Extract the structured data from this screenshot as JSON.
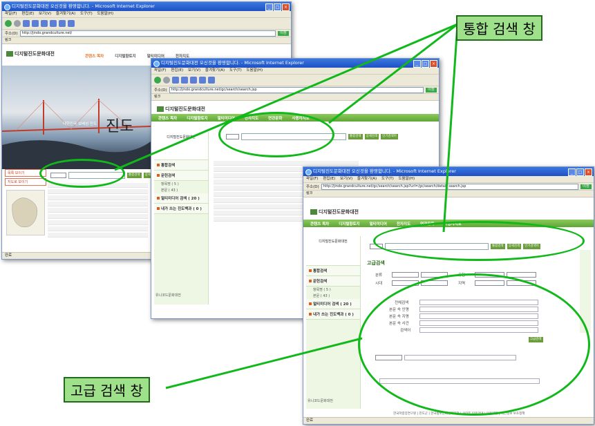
{
  "browser": {
    "title_suffix": "Microsoft Internet Explorer",
    "title_prefix": "디지털진도문화대전 오신것을 환영합니다.",
    "menu": [
      "파일(F)",
      "편집(E)",
      "보기(V)",
      "즐겨찾기(A)",
      "도구(T)",
      "도움말(H)"
    ],
    "toolbar": [
      "뒤로",
      "앞으로",
      "중지",
      "새로고침",
      "홈",
      "검색",
      "즐겨찾기",
      "인쇄"
    ],
    "address_label": "주소(D)",
    "go_label": "이동",
    "links_label": "링크",
    "status_text": "완료",
    "win1_address": "http://jindo.grandculture.net/",
    "win2_address": "http://jindo.grandculture.net/gc/search/search.jsp",
    "win3_address": "http://jindo.grandculture.net/gc/search/search.jsp?url=/gc/search/detail_search.jsp"
  },
  "site": {
    "name": "디지털진도문화대전",
    "nav": [
      "콘텐츠 목차",
      "디지털향토지",
      "멀티미디어",
      "전자지도",
      "연관문화",
      "사용자지도"
    ],
    "search_buttons": [
      "통합검색",
      "상세검색",
      "인기검색어",
      "테마/이야기마당"
    ],
    "home_hero_text": "진도",
    "home_slogan": "대한민국 보배섬 진도",
    "home_buttons": [
      "목록 보이기",
      "지도로 보이기"
    ],
    "sidebar_title": "통합검색",
    "sidebar_items": [
      {
        "label": "통합검색",
        "subs": []
      },
      {
        "label": "문헌검색",
        "subs": [
          "항목명 ( 5 )",
          "본문 ( 43 )"
        ]
      },
      {
        "label": "멀티미디어 검색 ( 20 )",
        "subs": []
      },
      {
        "label": "내가 쓰는 진도백과 ( 0 )",
        "subs": []
      }
    ],
    "detail_title": "고급검색",
    "detail_labels": [
      "분류",
      "유형",
      "시대",
      "지역",
      "전체검색",
      "본문 속 인명",
      "본문 속 지명",
      "본문 속 사건",
      "검색어"
    ],
    "footer": "한국학중앙연구원 | 진도군 | 한국향토문화전자대전 | 사이트 이용안내 | 이용약관 | 개인정보 보호정책",
    "partner_badge": "유니코드문화대전"
  },
  "callouts": {
    "integrated_search": "통합 검색 창",
    "advanced_search": "고급 검색 창"
  },
  "colors": {
    "nav_green": "#6cb843",
    "callout_fill": "#9fe08a",
    "ellipse_stroke": "#11b81a",
    "titlebar_blue": "#2a64d8"
  }
}
